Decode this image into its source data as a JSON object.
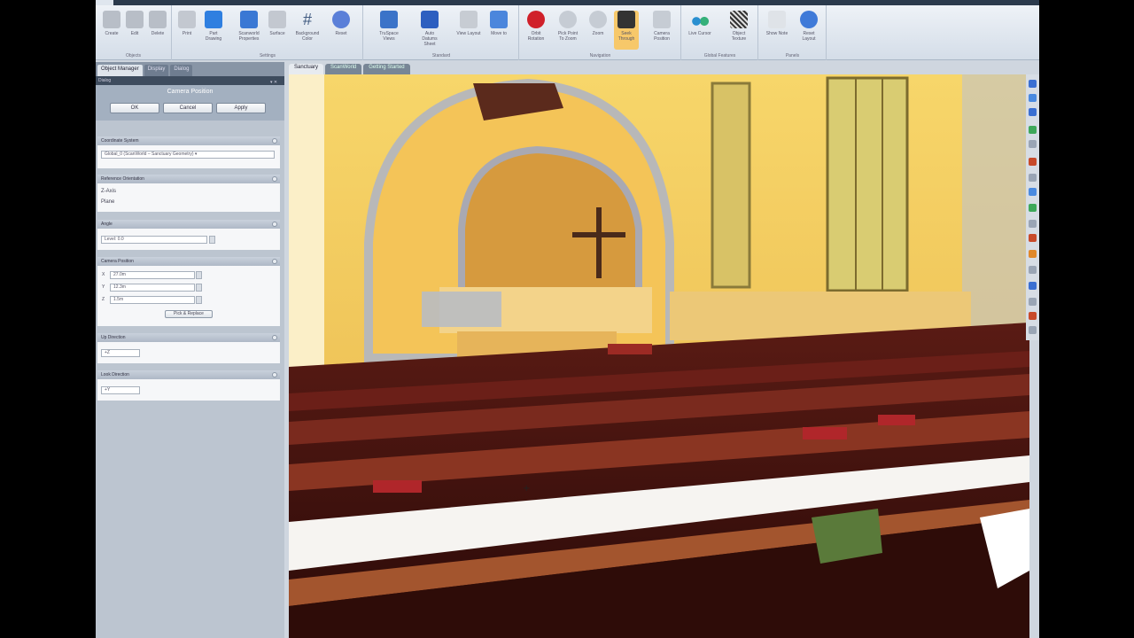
{
  "ribbon": {
    "tabs": [
      "",
      "",
      "",
      "",
      "",
      ""
    ],
    "groups": [
      {
        "label": "Objects",
        "tools": [
          {
            "label": "Create"
          },
          {
            "label": "Edit"
          },
          {
            "label": "Delete"
          }
        ]
      },
      {
        "label": "Settings",
        "tools": [
          {
            "label": "Print"
          },
          {
            "label": "Part Drawing"
          },
          {
            "label": "Scanworld Properties"
          },
          {
            "label": "Surface"
          },
          {
            "label": "Background Color"
          },
          {
            "label": "Reset"
          }
        ]
      },
      {
        "label": "Standard",
        "tools": [
          {
            "label": "TruSpace Views"
          },
          {
            "label": "Auto Datums Sheet"
          },
          {
            "label": "View Layout"
          },
          {
            "label": "Move to"
          }
        ]
      },
      {
        "label": "Navigation",
        "tools": [
          {
            "label": "Orbit Rotation"
          },
          {
            "label": "Pick Point To Zoom"
          },
          {
            "label": "Zoom"
          },
          {
            "label": "Seek Through"
          },
          {
            "label": "Camera Position"
          }
        ]
      },
      {
        "label": "Global Features",
        "tools": [
          {
            "label": "Live Cursor"
          },
          {
            "label": "Object Texture"
          }
        ]
      },
      {
        "label": "Panels",
        "tools": [
          {
            "label": "Show Note"
          },
          {
            "label": "Reset Layout"
          }
        ]
      }
    ]
  },
  "left_panel": {
    "tabs": [
      "Object Manager",
      "Display",
      "Dialog"
    ],
    "header": "Dialog",
    "title": "Camera Position",
    "buttons": {
      "ok": "OK",
      "cancel": "Cancel",
      "apply": "Apply"
    },
    "coord_section": {
      "label": "Coordinate System",
      "value": "Global_0 (ScanWorld – Sanctuary Geometry) ▾"
    },
    "reference_section": {
      "label": "Reference Orientation",
      "opt1": "Z-Axis",
      "opt2": "Plane"
    },
    "angle_section": {
      "label": "Angle",
      "value": "Level: 0.0"
    },
    "position_section": {
      "label": "Camera Position",
      "x_label": "X",
      "y_label": "Y",
      "z_label": "Z",
      "x": "27.0m",
      "y": "12.3m",
      "z": "1.5m",
      "pick_button": "Pick & Replace"
    },
    "dir_section": {
      "label": "Up Direction",
      "value": "+Z"
    },
    "look_section": {
      "label": "Look Direction",
      "value": "+Y"
    }
  },
  "view_tabs": [
    "Sanctuary",
    "ScanWorld",
    "Getting Started"
  ],
  "viewport": {
    "scene": "point-cloud-church-interior"
  },
  "colors": {
    "ribbon_accent": "#2f6fd6",
    "panel": "#bcc5d0",
    "wall": "#f2c35a",
    "pews": "#4a1410"
  }
}
